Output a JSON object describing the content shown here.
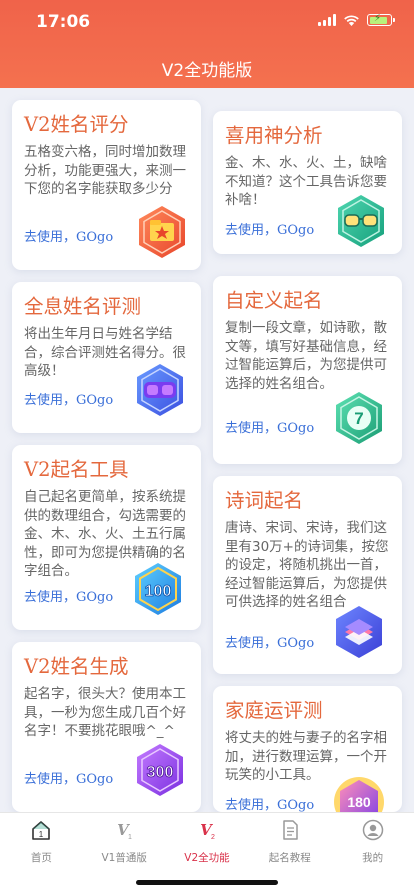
{
  "status_bar": {
    "time": "17:06"
  },
  "header": {
    "title": "V2全功能版"
  },
  "cards": [
    {
      "title": "V2姓名评分",
      "desc": "五格变六格，同时增加数理分析，功能更强大，来测一下您的名字能获取多少分",
      "link": "去使用，GOgo",
      "badge": "folder-star-badge-icon"
    },
    {
      "title": "喜用神分析",
      "desc": "金、木、水、火、土，缺啥不知道？这个工具告诉您要补啥！",
      "link": "去使用，GOgo",
      "badge": "glasses-badge-icon"
    },
    {
      "title": "全息姓名评测",
      "desc": "将出生年月日与姓名学结合，综合评测姓名得分。很高级！",
      "link": "去使用，GOgo",
      "badge": "vr-goggles-badge-icon"
    },
    {
      "title": "自定义起名",
      "desc": "复制一段文章，如诗歌，散文等，填写好基础信息，经过智能运算后，为您提供可选择的姓名组合。",
      "link": "去使用，GOgo",
      "badge": "number-7-badge-icon"
    },
    {
      "title": "V2起名工具",
      "desc": "自己起名更简单，按系统提供的数理组合，勾选需要的金、木、水、火、土五行属性，即可为您提供精确的名字组合。",
      "link": "去使用，GOgo",
      "badge": "100-badge-icon"
    },
    {
      "title": "诗词起名",
      "desc": "唐诗、宋词、宋诗，我们这里有30万+的诗词集，按您的设定，将随机挑出一首，经过智能运算后，为您提供可供选择的姓名组合",
      "link": "去使用，GOgo",
      "badge": "book-stack-badge-icon"
    },
    {
      "title": "V2姓名生成",
      "desc": "起名字，很头大？使用本工具，一秒为您生成几百个好名字！不要挑花眼哦^_^",
      "link": "去使用，GOgo",
      "badge": "300-badge-icon"
    },
    {
      "title": "家庭运评测",
      "desc": "将丈夫的姓与妻子的名字相加，进行数理运算，一个开玩笑的小工具。",
      "link": "去使用，GOgo",
      "badge": "180-badge-icon"
    }
  ],
  "tabbar": {
    "items": [
      {
        "label": "首页",
        "icon": "home-icon"
      },
      {
        "label": "V1普通版",
        "icon": "v1-icon"
      },
      {
        "label": "V2全功能",
        "icon": "v2-icon",
        "active": true
      },
      {
        "label": "起名教程",
        "icon": "document-icon"
      },
      {
        "label": "我的",
        "icon": "user-icon"
      }
    ]
  },
  "colors": {
    "accent": "#f0634a",
    "title": "#e4683d",
    "link": "#3a6fd8",
    "active_tab": "#d9324a"
  }
}
